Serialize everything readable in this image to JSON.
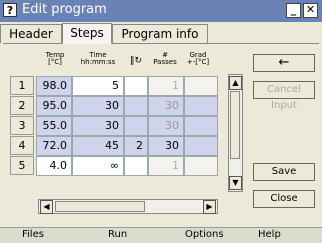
{
  "window": {
    "help_glyph": "?",
    "title": "Edit program",
    "minimize_glyph": "_",
    "close_glyph": "✕"
  },
  "tabs": [
    {
      "label": "Header"
    },
    {
      "label": "Steps"
    },
    {
      "label": "Program info"
    }
  ],
  "grid": {
    "headers": {
      "temp": "Temp\n[°C]",
      "time": "Time\nhh:mm:ss",
      "loop": "‖↻",
      "passes": "#\nPasses",
      "grad": "Grad\n+-[°C]"
    },
    "rows": [
      {
        "num": "1",
        "temp": "98.0",
        "time": "5",
        "loop": "",
        "passes": "1",
        "grad": ""
      },
      {
        "num": "2",
        "temp": "95.0",
        "time": "30",
        "loop": "",
        "passes": "30",
        "grad": ""
      },
      {
        "num": "3",
        "temp": "55.0",
        "time": "30",
        "loop": "",
        "passes": "30",
        "grad": ""
      },
      {
        "num": "4",
        "temp": "72.0",
        "time": "45",
        "loop": "2",
        "passes": "30",
        "grad": ""
      },
      {
        "num": "5",
        "temp": "4.0",
        "time": "∞",
        "loop": "",
        "passes": "1",
        "grad": ""
      }
    ]
  },
  "buttons": {
    "back": "←",
    "cancel_input": "Cancel Input",
    "save": "Save",
    "close": "Close"
  },
  "scroll": {
    "up": "▲",
    "down": "▼",
    "left": "◀",
    "right": "▶"
  },
  "menu": {
    "files": "Files",
    "run": "Run",
    "options": "Options",
    "help": "Help"
  }
}
